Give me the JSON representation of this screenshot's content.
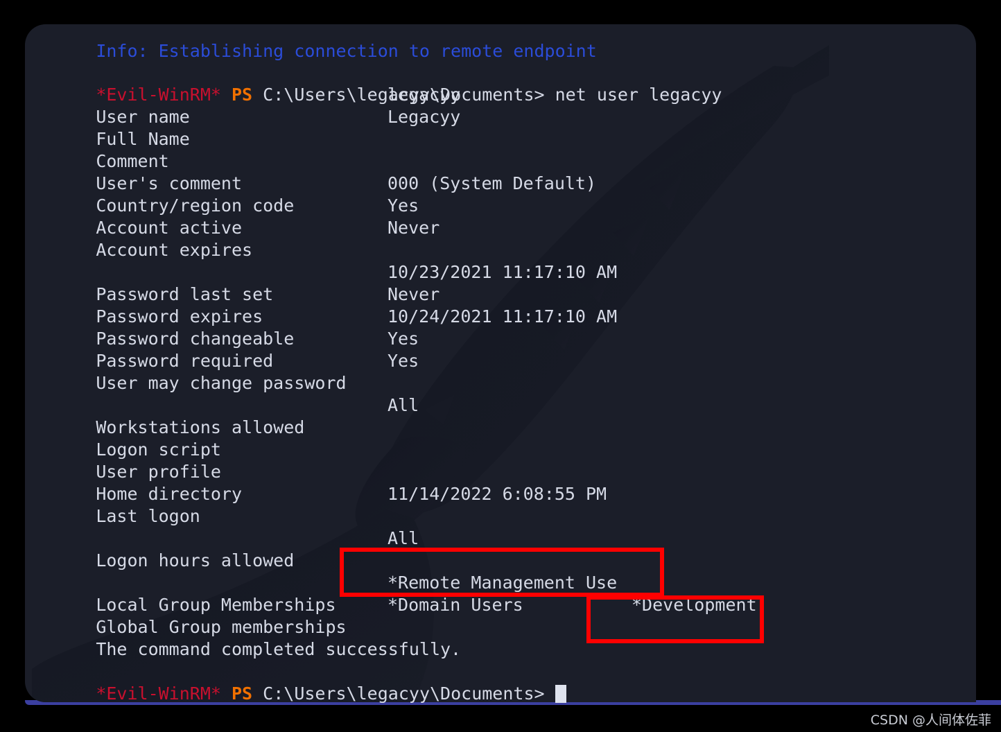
{
  "terminal": {
    "info_line": {
      "text": "Info: Establishing connection to remote endpoint",
      "color": "#2b4cd8"
    },
    "prompt": {
      "shell_tag": "*Evil-WinRM*",
      "shell_tag_color": "#c8102e",
      "ps_label": "PS",
      "ps_color": "#f07000",
      "path": "C:\\Users\\legacyy\\Documents>",
      "command": "net user legacyy"
    },
    "bottom_prompt": {
      "shell_tag": "*Evil-WinRM*",
      "ps_label": "PS",
      "path": "C:\\Users\\legacyy\\Documents>",
      "command": ""
    },
    "output_rows": [
      {
        "label": "User name",
        "value": "legacyy"
      },
      {
        "label": "Full Name",
        "value": "Legacyy"
      },
      {
        "label": "Comment",
        "value": ""
      },
      {
        "label": "User's comment",
        "value": ""
      },
      {
        "label": "Country/region code",
        "value": "000 (System Default)"
      },
      {
        "label": "Account active",
        "value": "Yes"
      },
      {
        "label": "Account expires",
        "value": "Never"
      },
      {
        "label": "",
        "value": ""
      },
      {
        "label": "Password last set",
        "value": "10/23/2021 11:17:10 AM"
      },
      {
        "label": "Password expires",
        "value": "Never"
      },
      {
        "label": "Password changeable",
        "value": "10/24/2021 11:17:10 AM"
      },
      {
        "label": "Password required",
        "value": "Yes"
      },
      {
        "label": "User may change password",
        "value": "Yes"
      },
      {
        "label": "",
        "value": ""
      },
      {
        "label": "Workstations allowed",
        "value": "All"
      },
      {
        "label": "Logon script",
        "value": ""
      },
      {
        "label": "User profile",
        "value": ""
      },
      {
        "label": "Home directory",
        "value": ""
      },
      {
        "label": "Last logon",
        "value": "11/14/2022 6:08:55 PM"
      },
      {
        "label": "",
        "value": ""
      },
      {
        "label": "Logon hours allowed",
        "value": "All"
      },
      {
        "label": "",
        "value": ""
      },
      {
        "label": "Local Group Memberships",
        "value": "*Remote Management Use"
      },
      {
        "label": "Global Group memberships",
        "value": "*Domain Users",
        "value2": "*Development"
      },
      {
        "label": "The command completed successfully.",
        "value": ""
      }
    ],
    "colors": {
      "background": "#1b1e29",
      "foreground": "#d6dae6",
      "accent_red": "#c8102e",
      "accent_orange": "#f07000",
      "accent_blue": "#2b4cd8",
      "annotation_red": "#ff0000",
      "strip_blue": "#3b3fa0"
    }
  },
  "annotations": [
    {
      "name": "local-group-highlight",
      "target": "*Remote Management Use"
    },
    {
      "name": "global-group-highlight",
      "target": "*Development"
    }
  ],
  "watermark": {
    "text": "CSDN @人间体佐菲"
  }
}
